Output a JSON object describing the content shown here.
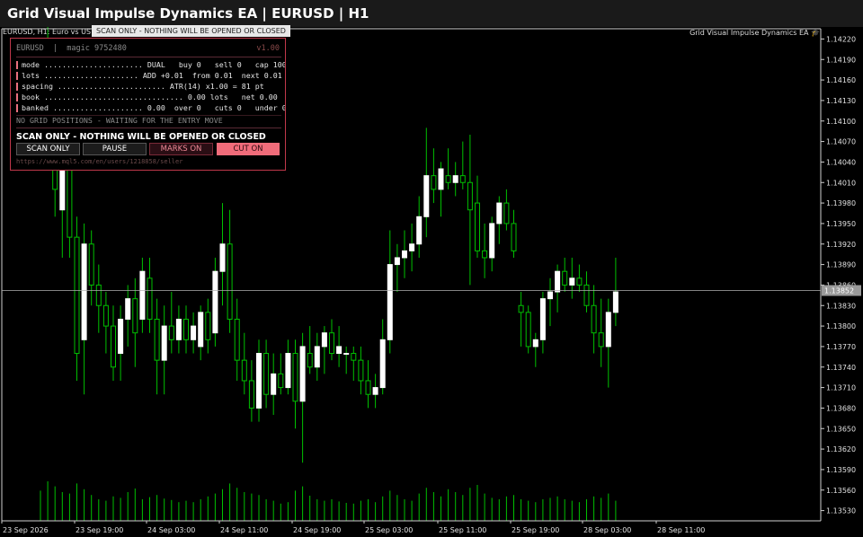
{
  "window": {
    "title": "Grid Visual Impulse Dynamics EA  |  EURUSD  |  H1"
  },
  "chart_header": {
    "symbol_label": "EURUSD, H1:  Euro vs US D",
    "ea_label": "Grid Visual Impulse Dynamics EA 🎓",
    "banner": "SCAN ONLY - NOTHING WILL BE OPENED OR CLOSED"
  },
  "panel": {
    "header": "EURUSD  |  magic 9752480",
    "version": "v1.00",
    "rows": [
      {
        "text": "mode ...................... DUAL   buy 0   sell 0   cap 100"
      },
      {
        "text": "lots ..................... ADD +0.01  from 0.01  next 0.01"
      },
      {
        "text": "spacing ........................ ATR(14) x1.00 = 81 pt"
      },
      {
        "text": "book ............................... 0.00 lots   net 0.00"
      },
      {
        "text": "banked .................... 0.00  over 0   cuts 0   under 0"
      }
    ],
    "waiting": "NO GRID POSITIONS - WAITING FOR THE ENTRY MOVE",
    "scan_text": "SCAN ONLY - NOTHING WILL BE OPENED OR CLOSED",
    "buttons": {
      "scan_only": "SCAN ONLY",
      "pause": "PAUSE",
      "marks_on": "MARKS ON",
      "cut_on": "CUT ON"
    },
    "url": "https://www.mql5.com/en/users/1218858/seller",
    "colors": {
      "accent": "#f06c7a",
      "border": "#c0384a"
    }
  },
  "chart_data": {
    "type": "candlestick",
    "symbol": "EURUSD",
    "timeframe": "H1",
    "y_ticks": [
      "1.14220",
      "1.14190",
      "1.14160",
      "1.14130",
      "1.14100",
      "1.14070",
      "1.14040",
      "1.14010",
      "1.13980",
      "1.13950",
      "1.13920",
      "1.13890",
      "1.13860",
      "1.13830",
      "1.13800",
      "1.13770",
      "1.13740",
      "1.13710",
      "1.13680",
      "1.13650",
      "1.13620",
      "1.13590",
      "1.13560",
      "1.13530"
    ],
    "ylim": [
      1.13515,
      1.14235
    ],
    "current_price": "1.13852",
    "current_price_value": 1.13852,
    "x_ticks": [
      "23 Sep 2026",
      "23 Sep 19:00",
      "24 Sep 03:00",
      "24 Sep 11:00",
      "24 Sep 19:00",
      "25 Sep 03:00",
      "25 Sep 11:00",
      "25 Sep 19:00",
      "28 Sep 03:00",
      "28 Sep 11:00"
    ],
    "colors": {
      "bull": "#ffffff",
      "bear": "#00c000",
      "wick": "#00c000",
      "volume": "#00c000",
      "grid_line": "#b0b0b0"
    },
    "candles": [
      {
        "o": 1.1412,
        "h": 1.1422,
        "l": 1.141,
        "c": 1.142,
        "v": 0.42
      },
      {
        "o": 1.1419,
        "h": 1.1425,
        "l": 1.1406,
        "c": 1.1408,
        "v": 0.55
      },
      {
        "o": 1.1408,
        "h": 1.141,
        "l": 1.1396,
        "c": 1.14,
        "v": 0.48
      },
      {
        "o": 1.1397,
        "h": 1.1406,
        "l": 1.139,
        "c": 1.1405,
        "v": 0.4
      },
      {
        "o": 1.1405,
        "h": 1.1406,
        "l": 1.139,
        "c": 1.1393,
        "v": 0.38
      },
      {
        "o": 1.1393,
        "h": 1.1396,
        "l": 1.1372,
        "c": 1.1376,
        "v": 0.52
      },
      {
        "o": 1.1378,
        "h": 1.1395,
        "l": 1.137,
        "c": 1.1392,
        "v": 0.44
      },
      {
        "o": 1.1392,
        "h": 1.1394,
        "l": 1.1383,
        "c": 1.1386,
        "v": 0.36
      },
      {
        "o": 1.1386,
        "h": 1.1389,
        "l": 1.1379,
        "c": 1.1383,
        "v": 0.3
      },
      {
        "o": 1.1383,
        "h": 1.1385,
        "l": 1.1376,
        "c": 1.138,
        "v": 0.28
      },
      {
        "o": 1.138,
        "h": 1.1383,
        "l": 1.1372,
        "c": 1.1374,
        "v": 0.34
      },
      {
        "o": 1.1376,
        "h": 1.1383,
        "l": 1.1372,
        "c": 1.1381,
        "v": 0.32
      },
      {
        "o": 1.1381,
        "h": 1.1386,
        "l": 1.1377,
        "c": 1.1384,
        "v": 0.4
      },
      {
        "o": 1.1384,
        "h": 1.1387,
        "l": 1.1374,
        "c": 1.1379,
        "v": 0.45
      },
      {
        "o": 1.1381,
        "h": 1.139,
        "l": 1.1379,
        "c": 1.1388,
        "v": 0.3
      },
      {
        "o": 1.1387,
        "h": 1.139,
        "l": 1.1379,
        "c": 1.1381,
        "v": 0.33
      },
      {
        "o": 1.1381,
        "h": 1.1384,
        "l": 1.137,
        "c": 1.1375,
        "v": 0.36
      },
      {
        "o": 1.1375,
        "h": 1.1383,
        "l": 1.137,
        "c": 1.138,
        "v": 0.31
      },
      {
        "o": 1.138,
        "h": 1.1385,
        "l": 1.1376,
        "c": 1.1378,
        "v": 0.29
      },
      {
        "o": 1.1378,
        "h": 1.1383,
        "l": 1.1376,
        "c": 1.1381,
        "v": 0.26
      },
      {
        "o": 1.1381,
        "h": 1.1383,
        "l": 1.1376,
        "c": 1.1378,
        "v": 0.28
      },
      {
        "o": 1.1378,
        "h": 1.1382,
        "l": 1.1376,
        "c": 1.138,
        "v": 0.26
      },
      {
        "o": 1.1377,
        "h": 1.1383,
        "l": 1.1375,
        "c": 1.1382,
        "v": 0.3
      },
      {
        "o": 1.1382,
        "h": 1.1384,
        "l": 1.1376,
        "c": 1.1378,
        "v": 0.34
      },
      {
        "o": 1.1379,
        "h": 1.139,
        "l": 1.1377,
        "c": 1.1388,
        "v": 0.38
      },
      {
        "o": 1.1388,
        "h": 1.1398,
        "l": 1.1383,
        "c": 1.1392,
        "v": 0.44
      },
      {
        "o": 1.1392,
        "h": 1.1397,
        "l": 1.1379,
        "c": 1.1381,
        "v": 0.52
      },
      {
        "o": 1.1381,
        "h": 1.1384,
        "l": 1.1372,
        "c": 1.1375,
        "v": 0.46
      },
      {
        "o": 1.1375,
        "h": 1.1379,
        "l": 1.137,
        "c": 1.1372,
        "v": 0.4
      },
      {
        "o": 1.1372,
        "h": 1.1375,
        "l": 1.1366,
        "c": 1.1368,
        "v": 0.38
      },
      {
        "o": 1.1368,
        "h": 1.1378,
        "l": 1.1366,
        "c": 1.1376,
        "v": 0.36
      },
      {
        "o": 1.1376,
        "h": 1.1378,
        "l": 1.1368,
        "c": 1.137,
        "v": 0.3
      },
      {
        "o": 1.137,
        "h": 1.1376,
        "l": 1.1367,
        "c": 1.1373,
        "v": 0.28
      },
      {
        "o": 1.1373,
        "h": 1.1376,
        "l": 1.137,
        "c": 1.1371,
        "v": 0.24
      },
      {
        "o": 1.1371,
        "h": 1.1378,
        "l": 1.137,
        "c": 1.1376,
        "v": 0.26
      },
      {
        "o": 1.1376,
        "h": 1.1378,
        "l": 1.1365,
        "c": 1.1369,
        "v": 0.42
      },
      {
        "o": 1.1369,
        "h": 1.1379,
        "l": 1.136,
        "c": 1.1377,
        "v": 0.48
      },
      {
        "o": 1.1376,
        "h": 1.138,
        "l": 1.1373,
        "c": 1.1374,
        "v": 0.35
      },
      {
        "o": 1.1374,
        "h": 1.1379,
        "l": 1.1372,
        "c": 1.1377,
        "v": 0.3
      },
      {
        "o": 1.1377,
        "h": 1.138,
        "l": 1.1373,
        "c": 1.1379,
        "v": 0.28
      },
      {
        "o": 1.1379,
        "h": 1.1381,
        "l": 1.1375,
        "c": 1.1376,
        "v": 0.3
      },
      {
        "o": 1.1376,
        "h": 1.138,
        "l": 1.1374,
        "c": 1.1377,
        "v": 0.27
      },
      {
        "o": 1.1376,
        "h": 1.1377,
        "l": 1.1373,
        "c": 1.1376,
        "v": 0.25
      },
      {
        "o": 1.1376,
        "h": 1.1377,
        "l": 1.1372,
        "c": 1.1375,
        "v": 0.24
      },
      {
        "o": 1.1375,
        "h": 1.1377,
        "l": 1.137,
        "c": 1.1372,
        "v": 0.28
      },
      {
        "o": 1.1372,
        "h": 1.1375,
        "l": 1.1368,
        "c": 1.137,
        "v": 0.3
      },
      {
        "o": 1.137,
        "h": 1.1373,
        "l": 1.1368,
        "c": 1.1371,
        "v": 0.26
      },
      {
        "o": 1.1371,
        "h": 1.1381,
        "l": 1.137,
        "c": 1.1378,
        "v": 0.34
      },
      {
        "o": 1.1378,
        "h": 1.1394,
        "l": 1.1376,
        "c": 1.1389,
        "v": 0.42
      },
      {
        "o": 1.1389,
        "h": 1.1392,
        "l": 1.1385,
        "c": 1.139,
        "v": 0.36
      },
      {
        "o": 1.139,
        "h": 1.1394,
        "l": 1.1387,
        "c": 1.1391,
        "v": 0.3
      },
      {
        "o": 1.1391,
        "h": 1.1395,
        "l": 1.1388,
        "c": 1.1392,
        "v": 0.28
      },
      {
        "o": 1.1392,
        "h": 1.1399,
        "l": 1.139,
        "c": 1.1396,
        "v": 0.38
      },
      {
        "o": 1.1396,
        "h": 1.1409,
        "l": 1.1393,
        "c": 1.1402,
        "v": 0.46
      },
      {
        "o": 1.1402,
        "h": 1.1406,
        "l": 1.1398,
        "c": 1.14,
        "v": 0.4
      },
      {
        "o": 1.14,
        "h": 1.1404,
        "l": 1.1396,
        "c": 1.1403,
        "v": 0.34
      },
      {
        "o": 1.1402,
        "h": 1.1406,
        "l": 1.14,
        "c": 1.1401,
        "v": 0.44
      },
      {
        "o": 1.1401,
        "h": 1.1404,
        "l": 1.1399,
        "c": 1.1402,
        "v": 0.4
      },
      {
        "o": 1.1402,
        "h": 1.1407,
        "l": 1.14,
        "c": 1.1401,
        "v": 0.36
      },
      {
        "o": 1.1401,
        "h": 1.1408,
        "l": 1.1386,
        "c": 1.1397,
        "v": 0.46
      },
      {
        "o": 1.1398,
        "h": 1.1402,
        "l": 1.139,
        "c": 1.1391,
        "v": 0.5
      },
      {
        "o": 1.1391,
        "h": 1.1395,
        "l": 1.1387,
        "c": 1.139,
        "v": 0.38
      },
      {
        "o": 1.139,
        "h": 1.1396,
        "l": 1.1388,
        "c": 1.1395,
        "v": 0.32
      },
      {
        "o": 1.1395,
        "h": 1.1399,
        "l": 1.1392,
        "c": 1.1398,
        "v": 0.3
      },
      {
        "o": 1.1398,
        "h": 1.14,
        "l": 1.1394,
        "c": 1.1395,
        "v": 0.34
      },
      {
        "o": 1.1395,
        "h": 1.1397,
        "l": 1.139,
        "c": 1.1391,
        "v": 0.36
      },
      {
        "o": 1.1383,
        "h": 1.1385,
        "l": 1.1377,
        "c": 1.1382,
        "v": 0.3
      },
      {
        "o": 1.1382,
        "h": 1.1383,
        "l": 1.1376,
        "c": 1.1377,
        "v": 0.28
      },
      {
        "o": 1.1377,
        "h": 1.1379,
        "l": 1.1374,
        "c": 1.1378,
        "v": 0.26
      },
      {
        "o": 1.1378,
        "h": 1.1385,
        "l": 1.1376,
        "c": 1.1384,
        "v": 0.3
      },
      {
        "o": 1.1384,
        "h": 1.1387,
        "l": 1.138,
        "c": 1.1385,
        "v": 0.32
      },
      {
        "o": 1.1385,
        "h": 1.1389,
        "l": 1.1382,
        "c": 1.1388,
        "v": 0.34
      },
      {
        "o": 1.1388,
        "h": 1.139,
        "l": 1.1385,
        "c": 1.1386,
        "v": 0.3
      },
      {
        "o": 1.1386,
        "h": 1.139,
        "l": 1.1384,
        "c": 1.1387,
        "v": 0.28
      },
      {
        "o": 1.1387,
        "h": 1.1389,
        "l": 1.1385,
        "c": 1.1386,
        "v": 0.26
      },
      {
        "o": 1.1386,
        "h": 1.1388,
        "l": 1.1382,
        "c": 1.1383,
        "v": 0.3
      },
      {
        "o": 1.1383,
        "h": 1.1386,
        "l": 1.1376,
        "c": 1.1379,
        "v": 0.34
      },
      {
        "o": 1.1379,
        "h": 1.1384,
        "l": 1.1374,
        "c": 1.1377,
        "v": 0.32
      },
      {
        "o": 1.1377,
        "h": 1.1384,
        "l": 1.1371,
        "c": 1.1382,
        "v": 0.38
      },
      {
        "o": 1.1382,
        "h": 1.139,
        "l": 1.138,
        "c": 1.1385,
        "v": 0.28
      }
    ]
  }
}
